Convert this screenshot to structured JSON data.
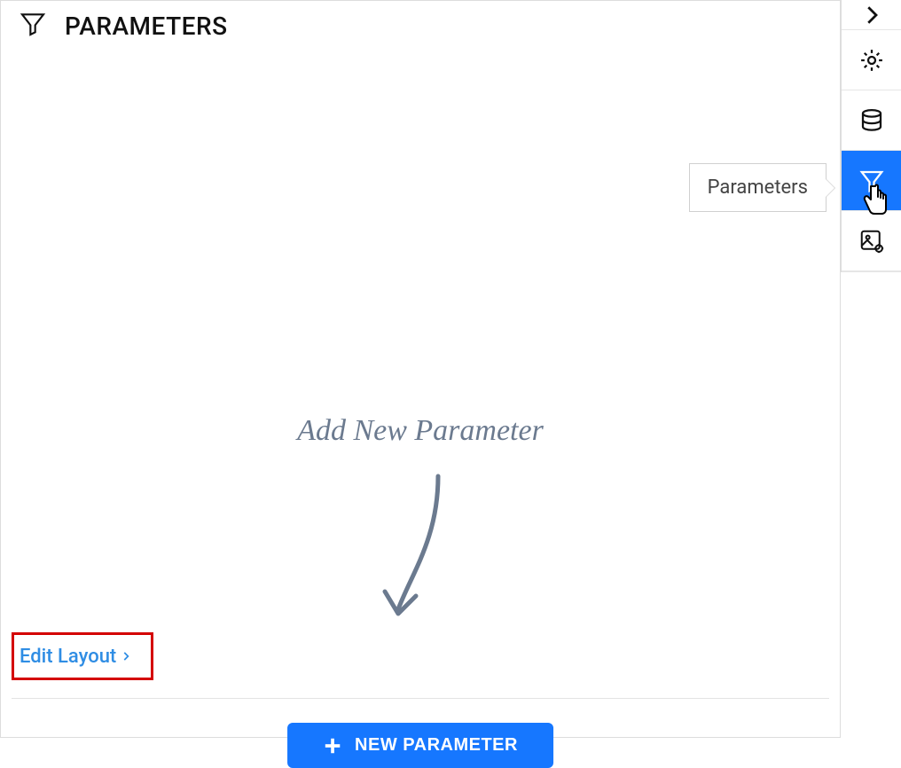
{
  "panel": {
    "title": "PARAMETERS",
    "handwriting_hint": "Add New Parameter",
    "edit_layout_label": "Edit Layout",
    "new_parameter_button": "NEW PARAMETER"
  },
  "tooltip": {
    "label": "Parameters"
  },
  "rail": {
    "items": [
      {
        "name": "collapse",
        "icon": "chevron-right-icon",
        "active": false
      },
      {
        "name": "settings",
        "icon": "gear-icon",
        "active": false
      },
      {
        "name": "data",
        "icon": "database-icon",
        "active": false
      },
      {
        "name": "parameters",
        "icon": "filter-icon",
        "active": true
      },
      {
        "name": "image-settings",
        "icon": "image-gear-icon",
        "active": false
      }
    ]
  },
  "colors": {
    "primary": "#1677ff",
    "highlight_box": "#d40000",
    "muted_text": "#6b7a8f"
  }
}
